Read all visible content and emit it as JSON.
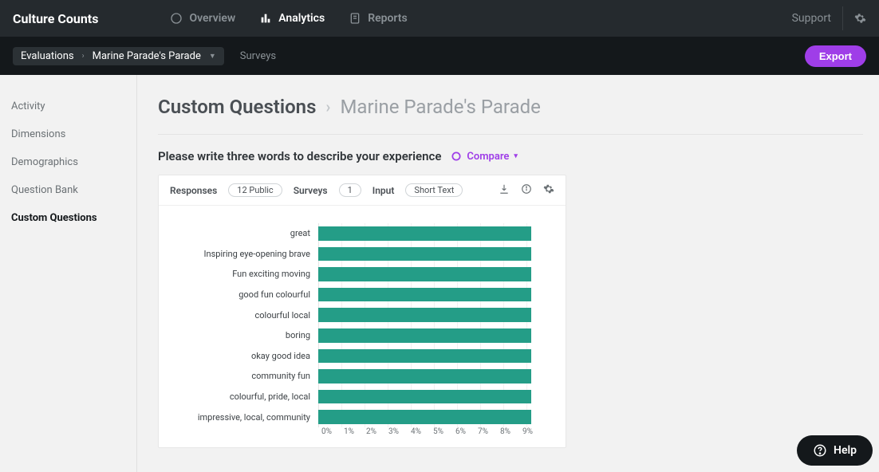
{
  "brand": "Culture Counts",
  "top_tabs": {
    "overview": "Overview",
    "analytics": "Analytics",
    "reports": "Reports"
  },
  "support_label": "Support",
  "breadcrumb": {
    "root": "Evaluations",
    "current": "Marine Parade's Parade"
  },
  "surveys_label": "Surveys",
  "export_label": "Export",
  "sidebar": {
    "items": [
      "Activity",
      "Dimensions",
      "Demographics",
      "Question Bank",
      "Custom Questions"
    ],
    "active_index": 4
  },
  "page": {
    "title": "Custom Questions",
    "sub": "Marine Parade's Parade"
  },
  "question": "Please write three words to describe your experience",
  "compare_label": "Compare",
  "card_meta": {
    "responses_label": "Responses",
    "responses_value": "12 Public",
    "surveys_label": "Surveys",
    "surveys_value": "1",
    "input_label": "Input",
    "input_value": "Short Text"
  },
  "chart_data": {
    "type": "bar",
    "orientation": "horizontal",
    "xlabel": "",
    "ylabel": "",
    "xlim": [
      0,
      9
    ],
    "ticks": [
      "0%",
      "1%",
      "2%",
      "3%",
      "4%",
      "5%",
      "6%",
      "7%",
      "8%",
      "9%"
    ],
    "categories": [
      "great",
      "Inspiring eye-opening brave",
      "Fun exciting moving",
      "good fun colourful",
      "colourful local",
      "boring",
      "okay good idea",
      "community fun",
      "colourful, pride, local",
      "impressive, local, community"
    ],
    "values": [
      8.3,
      8.3,
      8.3,
      8.3,
      8.3,
      8.3,
      8.3,
      8.3,
      8.3,
      8.3
    ],
    "bar_color": "#249d87"
  },
  "help_label": "Help"
}
